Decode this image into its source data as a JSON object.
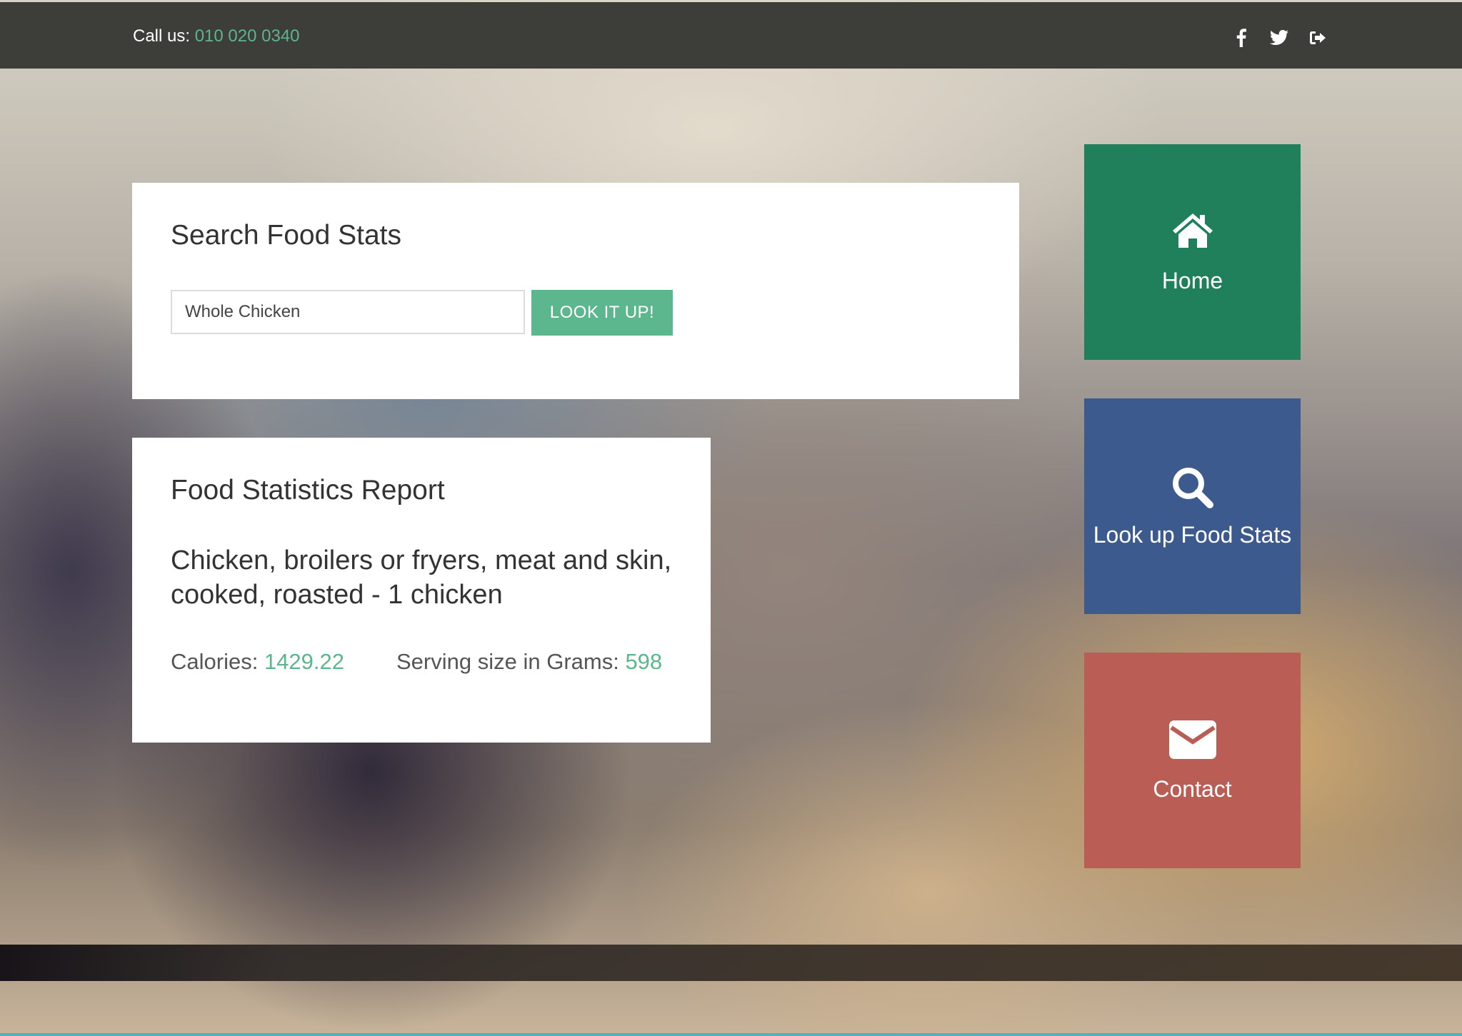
{
  "topbar": {
    "call_label": "Call us: ",
    "phone": "010 020 0340",
    "social": [
      "facebook-icon",
      "twitter-icon",
      "sign-out-icon"
    ]
  },
  "search": {
    "title": "Search Food Stats",
    "input_value": "Whole Chicken",
    "button_label": "LOOK IT UP!"
  },
  "report": {
    "title": "Food Statistics Report",
    "description": "Chicken, broilers or fryers, meat and skin, cooked, roasted - 1 chicken",
    "calories_label": "Calories: ",
    "calories_value": "1429.22",
    "serving_label": "Serving size in Grams: ",
    "serving_value": "598"
  },
  "nav_tiles": [
    {
      "label": "Home",
      "icon": "home-icon",
      "color": "#20805c"
    },
    {
      "label": "Look up Food Stats",
      "icon": "search-icon",
      "color": "#3d5a8f"
    },
    {
      "label": "Contact",
      "icon": "envelope-icon",
      "color": "#ba5d55"
    }
  ],
  "colors": {
    "accent": "#5cb68e",
    "topbar": "#3d3d3a"
  }
}
